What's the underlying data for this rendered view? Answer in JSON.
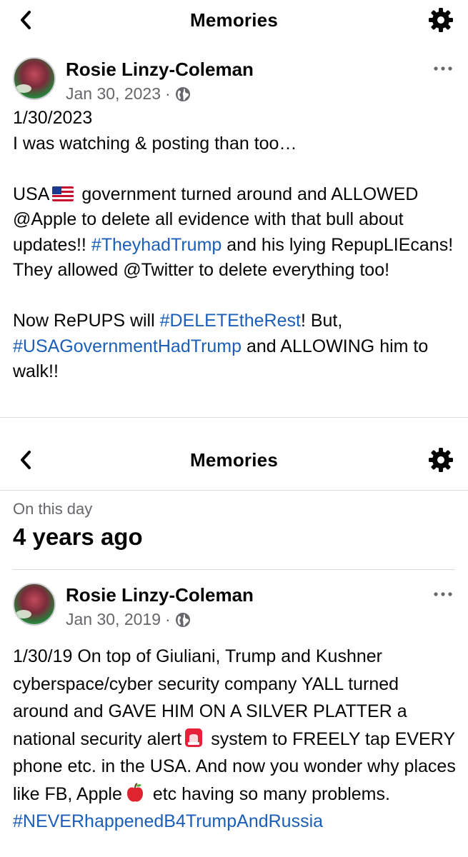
{
  "header_top": {
    "title": "Memories"
  },
  "post1": {
    "author": "Rosie Linzy-Coleman",
    "date": "Jan 30, 2023",
    "separator": "·",
    "line1": "1/30/2023",
    "line2": "I was watching & posting than too…",
    "p2_usa": "USA",
    "p2_a": "government turned around and ALLOWED @Apple to delete all evidence with that bull about updates!!",
    "tag1": "#TheyhadTrump",
    "p2_b": "and his lying RepupLIEcans! They allowed @Twitter to delete everything too!",
    "p3_a": "Now RePUPS will",
    "tag2": "#DELETEtheRest",
    "p3_b": "!  But,",
    "tag3": "#USAGovernmentHadTrump",
    "p3_c": "and ALLOWING him to walk!!"
  },
  "header_bottom": {
    "title": "Memories"
  },
  "memory": {
    "label": "On this day",
    "age": "4 years ago"
  },
  "post2": {
    "author": "Rosie Linzy-Coleman",
    "date": "Jan 30, 2019",
    "separator": "·",
    "t1": "1/30/19  On top of Giuliani, Trump and Kushner cyberspace/cyber security company YALL turned around and GAVE HIM ON A SILVER PLATTER a national security alert",
    "t2": "system to FREELY tap EVERY phone etc.  in the USA.  And now you wonder why places like FB, Apple",
    "t3": "etc having so many problems.",
    "tag": "#NEVERhappenedB4TrumpAndRussia"
  },
  "icons": {
    "back": "chevron-left-icon",
    "settings": "gear-icon",
    "more": "ellipsis-icon",
    "privacy": "globe-icon",
    "flag": "us-flag-emoji",
    "siren": "police-light-emoji",
    "apple": "red-apple-emoji"
  },
  "colors": {
    "hashtag": "#1b5fb8",
    "meta": "#65676b",
    "divider": "#dadde1"
  }
}
